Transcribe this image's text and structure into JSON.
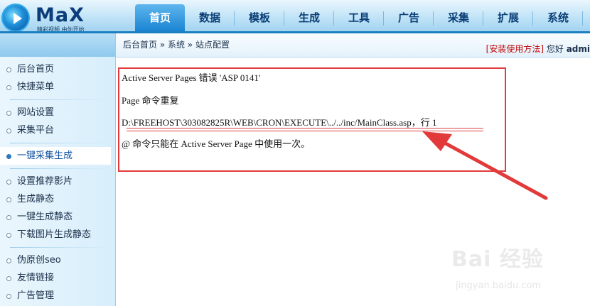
{
  "brand": {
    "logo_text": "MaX",
    "tagline": "精彩视频 由你开始"
  },
  "nav": {
    "tabs": [
      {
        "label": "首页",
        "active": true
      },
      {
        "label": "数据"
      },
      {
        "label": "模板"
      },
      {
        "label": "生成"
      },
      {
        "label": "工具"
      },
      {
        "label": "广告"
      },
      {
        "label": "采集"
      },
      {
        "label": "扩展"
      },
      {
        "label": "系统"
      }
    ]
  },
  "breadcrumb": "后台首页 » 系统 » 站点配置",
  "user": {
    "install_link": "[安装使用方法]",
    "greeting": "您好",
    "name": "admi"
  },
  "sidebar": {
    "items": [
      {
        "label": "后台首页"
      },
      {
        "label": "快捷菜单"
      },
      {
        "label": "网站设置"
      },
      {
        "label": "采集平台"
      },
      {
        "label": "一键采集生成",
        "active": true
      },
      {
        "label": "设置推荐影片"
      },
      {
        "label": "生成静态"
      },
      {
        "label": "一键生成静态"
      },
      {
        "label": "下载图片生成静态"
      },
      {
        "label": "伪原创seo"
      },
      {
        "label": "友情链接"
      },
      {
        "label": "广告管理"
      }
    ]
  },
  "error": {
    "line1": "Active Server Pages 错误 'ASP 0141'",
    "line2": "Page 命令重复",
    "line3": "D:\\FREEHOST\\303082825R\\WEB\\CRON\\EXECUTE\\../../inc/MainClass.asp，行 1",
    "line4": "@ 命令只能在 Active Server Page 中使用一次。"
  },
  "colors": {
    "annotation": "#e23a3a",
    "nav_active": "#1a84d2",
    "nav_text": "#0a3e76"
  },
  "watermark": {
    "text": "Bai 经验",
    "sub": "jingyan.baidu.com"
  }
}
